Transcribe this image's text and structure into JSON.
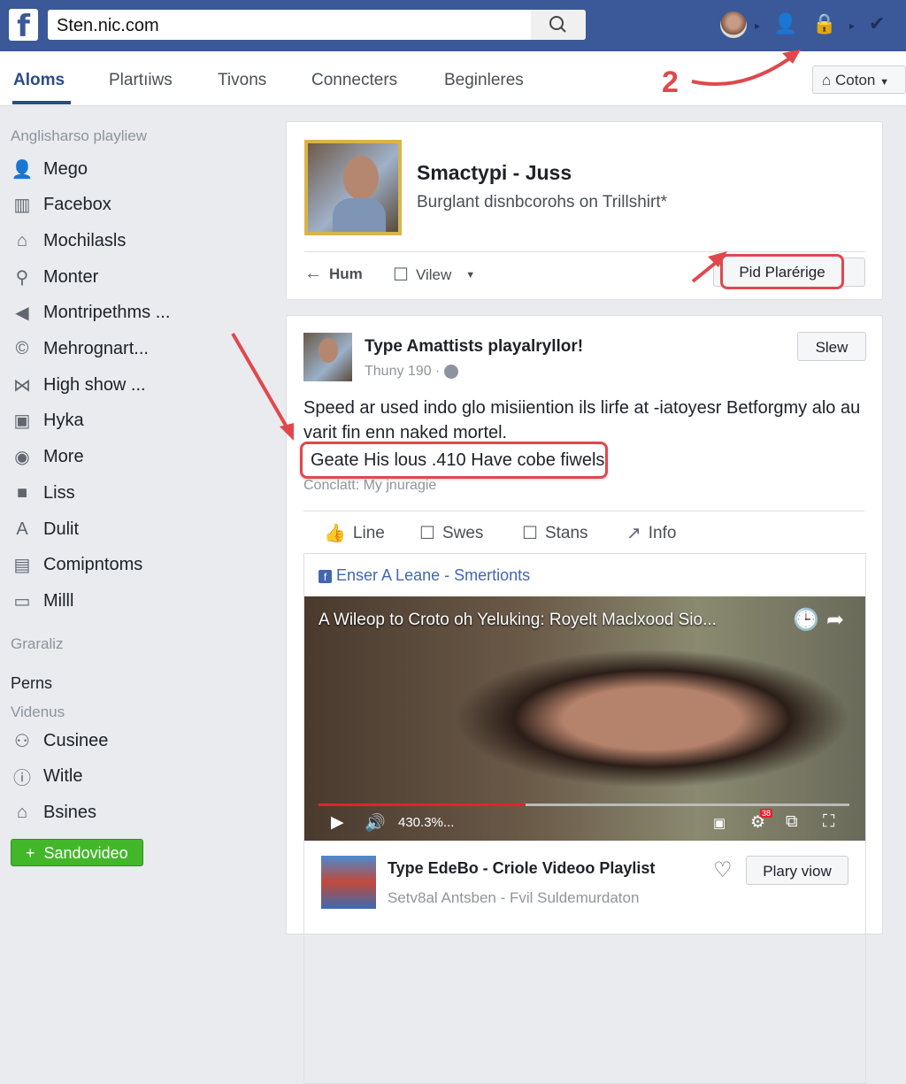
{
  "header": {
    "url": "Sten.nic.com",
    "brand_color": "#3b5998"
  },
  "tabs": [
    {
      "label": "Aloms",
      "active": true
    },
    {
      "label": "Plartıiws"
    },
    {
      "label": "Tivons"
    },
    {
      "label": "Connecters"
    },
    {
      "label": "Beginleres"
    }
  ],
  "coton_label": "Coton",
  "annotation_number": "2",
  "sidebar": {
    "heading": "Anglisharso playliew",
    "items": [
      {
        "label": "Mego",
        "icon": "person-icon"
      },
      {
        "label": "Facebox",
        "icon": "chart-icon"
      },
      {
        "label": "Mochilasls",
        "icon": "home-icon"
      },
      {
        "label": "Monter",
        "icon": "link-icon"
      },
      {
        "label": "Montripethms ...",
        "icon": "back-icon"
      },
      {
        "label": "Mehrognart...",
        "icon": "copyright-icon"
      },
      {
        "label": "High show ...",
        "icon": "bowtie-icon"
      },
      {
        "label": "Hyka",
        "icon": "photo-icon"
      },
      {
        "label": "More",
        "icon": "colorful-icon"
      },
      {
        "label": "Liss",
        "icon": "app-icon"
      },
      {
        "label": "Dulit",
        "icon": "a-icon"
      },
      {
        "label": "Comipntoms",
        "icon": "calendar-icon"
      },
      {
        "label": "Milll",
        "icon": "ticket-icon"
      }
    ],
    "heading2": "Graraliz",
    "section_perms": "Perns",
    "section_videos": "Videnus",
    "items2": [
      {
        "label": "Cusinee",
        "icon": "user-badge-icon"
      },
      {
        "label": "Witle",
        "icon": "info-icon"
      },
      {
        "label": "Bsines",
        "icon": "house-icon"
      }
    ],
    "button": "Sandovideo"
  },
  "card1": {
    "title": "Smactypi - Juss",
    "subtitle": "Burglant disnbcorohs on Trillshirt*",
    "back": "Hum",
    "view": "Vilew",
    "button": "Pid Plarérige"
  },
  "post": {
    "author": "Type Amattists playalryllor!",
    "meta": "Thuny 190 ·",
    "follow": "Slew",
    "text": "Speed ar used indo glo misiiention ils lirfe at -iatoyesr Betforgmy alo au varit fin enn naked mortel.",
    "highlight": "Geate His lous .410 Have cobe fiwels",
    "caption": "Conclatt: My jnuragie",
    "actions": [
      "Line",
      "Swes",
      "Stans",
      "Info"
    ],
    "page_link": "Enser A Leane - Smertionts",
    "video": {
      "title": "A Wileop to Croto oh Yeluking: Royelt Maclxood Sio...",
      "time": "430.3%...",
      "progress": 0.39,
      "badge": "38"
    },
    "playlist": {
      "title": "Type EdeBo - Criole Videoo Playlist",
      "subtitle": "Setv8al Antsben - Fvil Suldemurdaton",
      "button": "Plary viow"
    }
  }
}
